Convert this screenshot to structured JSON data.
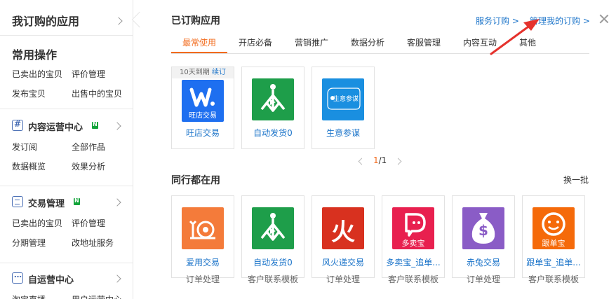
{
  "sidebar": {
    "title": "我订购的应用",
    "common": {
      "title": "常用操作",
      "links": [
        "已卖出的宝贝",
        "评价管理",
        "发布宝贝",
        "出售中的宝贝"
      ]
    },
    "content": {
      "title": "内容运营中心",
      "links": [
        "发订阅",
        "全部作品",
        "数据概览",
        "效果分析"
      ]
    },
    "trade": {
      "title": "交易管理",
      "links": [
        "已卖出的宝贝",
        "评价管理",
        "分期管理",
        "改地址服务"
      ]
    },
    "self": {
      "title": "自运营中心",
      "links": [
        "淘宝直播",
        "用户运营中心"
      ]
    }
  },
  "panel": {
    "title": "已订购应用",
    "service_link": "服务订购 >",
    "manage_link": "管理我的订购 >",
    "tabs": [
      "最常使用",
      "开店必备",
      "营销推广",
      "数据分析",
      "客服管理",
      "内容互动",
      "其他"
    ],
    "subscribed": [
      {
        "name": "旺店交易",
        "expire": "10天到期",
        "renew": "续订",
        "logo_text": "旺店交易"
      },
      {
        "name": "自动发货0"
      },
      {
        "name": "生意参谋",
        "logo_text": "生意参谋"
      }
    ],
    "pager": {
      "current": "1",
      "total": "/1"
    },
    "peers_title": "同行都在用",
    "swap": "换一批",
    "peers": [
      {
        "name": "爱用交易",
        "category": "订单处理"
      },
      {
        "name": "自动发货0",
        "category": "客户联系模板"
      },
      {
        "name": "风火递交易",
        "category": "订单处理",
        "logo_text": "火"
      },
      {
        "name": "多卖宝_追单...",
        "category": "客户联系模板",
        "logo_text": "多卖宝"
      },
      {
        "name": "赤兔交易",
        "category": "订单处理",
        "logo_text": "$"
      },
      {
        "name": "跟单宝_追单...",
        "category": "客户联系模板",
        "logo_text": "跟单宝"
      }
    ]
  },
  "colors": {
    "accent": "#f26b1d",
    "link": "#1a73c9",
    "arrow": "#e5322d"
  }
}
